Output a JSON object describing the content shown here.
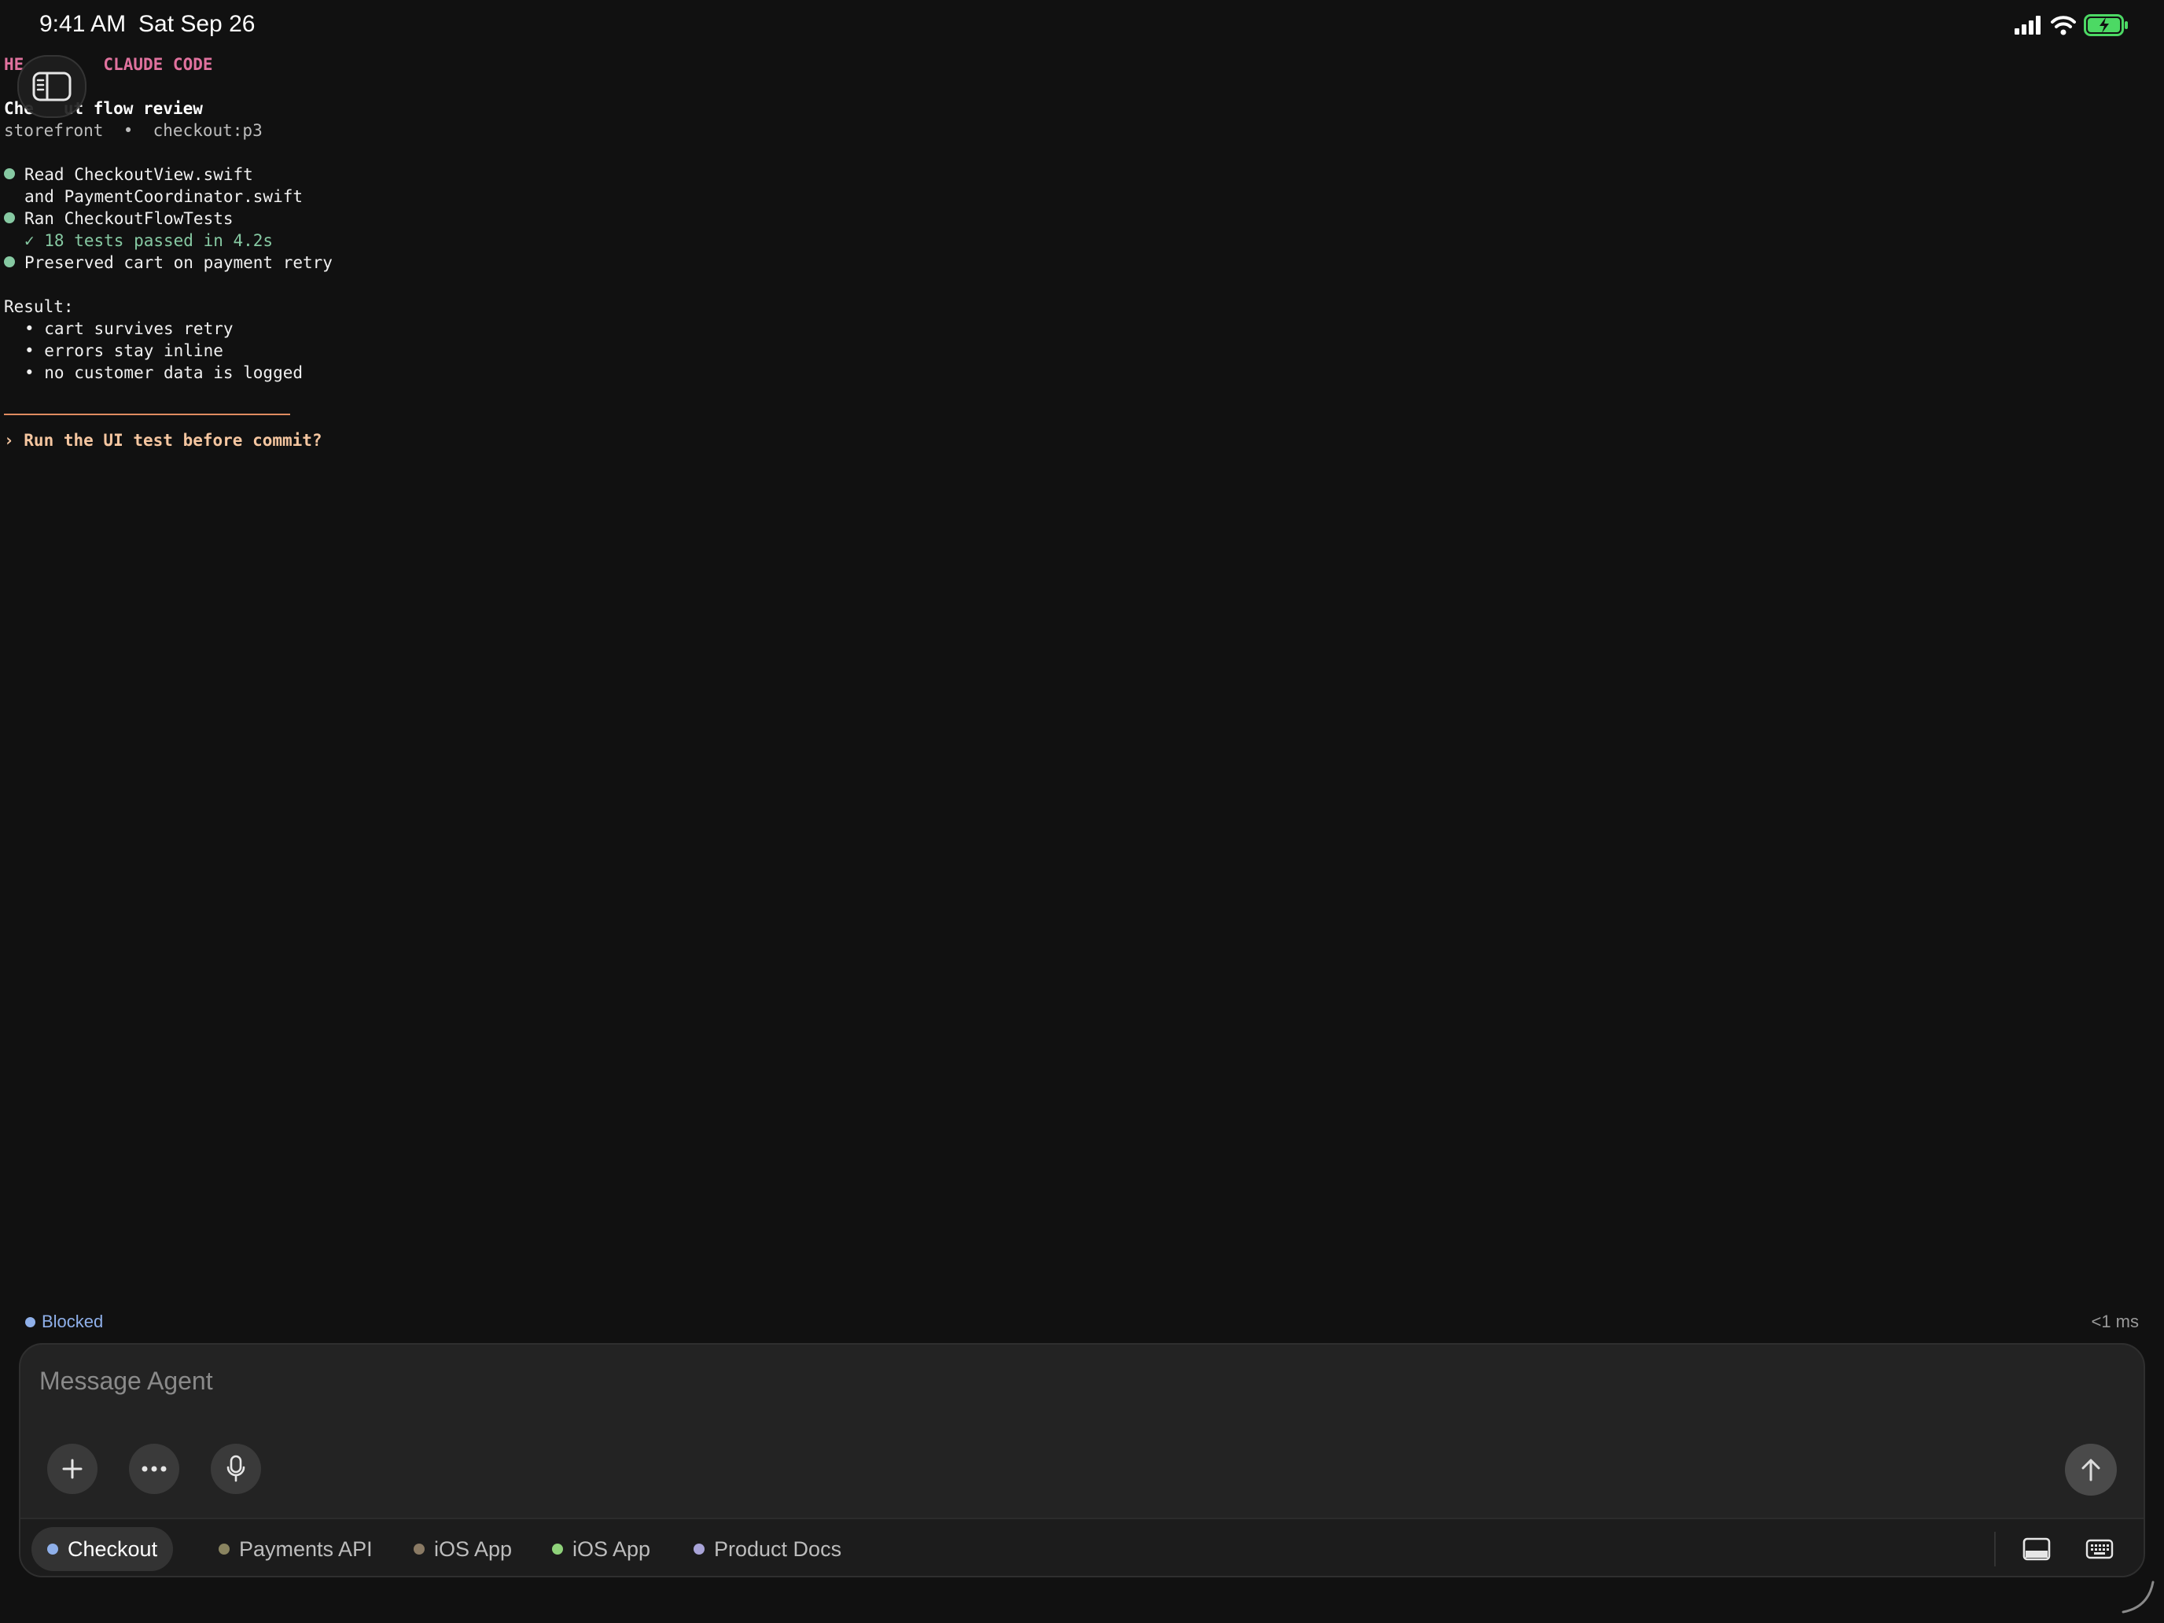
{
  "status_bar": {
    "time": "9:41 AM",
    "date": "Sat Sep 26"
  },
  "terminal": {
    "header": "HE        CLAUDE CODE",
    "title": "Che   ut flow review",
    "meta": "storefront  •  checkout:p3",
    "steps": [
      {
        "line1": "Read CheckoutView.swift",
        "line2": "and PaymentCoordinator.swift"
      },
      {
        "line1": "Ran CheckoutFlowTests",
        "line2": "✓ 18 tests passed in 4.2s"
      },
      {
        "line1": "Preserved cart on payment retry"
      }
    ],
    "result_label": "Result:",
    "results": [
      "• cart survives retry",
      "• errors stay inline",
      "• no customer data is logged"
    ],
    "prompt": "› Run the UI test before commit?"
  },
  "status": {
    "label": "Blocked",
    "latency": "<1 ms"
  },
  "composer": {
    "placeholder": "Message Agent"
  },
  "tabs": [
    {
      "label": "Checkout",
      "color": "#8fb0ea",
      "active": true
    },
    {
      "label": "Payments API",
      "color": "#8a8460",
      "active": false
    },
    {
      "label": "iOS App",
      "color": "#8a7a64",
      "active": false
    },
    {
      "label": "iOS App",
      "color": "#8fd27a",
      "active": false
    },
    {
      "label": "Product Docs",
      "color": "#a9a4d8",
      "active": false
    }
  ],
  "colors": {
    "background": "#111111",
    "accent": "#8fb0ea",
    "success": "#86c9a2",
    "header": "#e0729e"
  }
}
